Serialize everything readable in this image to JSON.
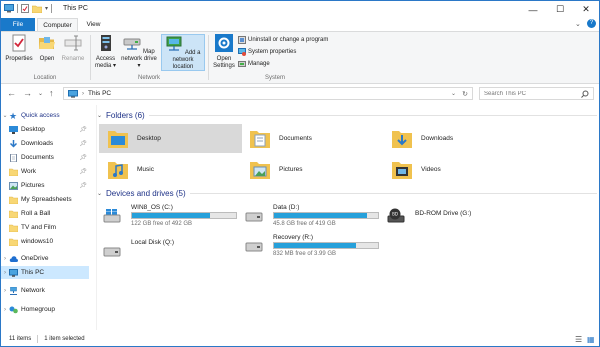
{
  "window": {
    "title": "This PC"
  },
  "tabs": {
    "file": "File",
    "computer": "Computer",
    "view": "View"
  },
  "ribbon": {
    "location": {
      "label": "Location",
      "properties": "Properties",
      "open": "Open",
      "rename": "Rename"
    },
    "network": {
      "label": "Network",
      "access_media": "Access media",
      "map_drive": "Map network drive",
      "add_location": "Add a network location"
    },
    "system": {
      "label": "System",
      "open_settings": "Open Settings",
      "uninstall": "Uninstall or change a program",
      "system_properties": "System properties",
      "manage": "Manage"
    }
  },
  "address": {
    "path": "This PC",
    "search_placeholder": "Search This PC"
  },
  "sidebar": {
    "quick_access": "Quick access",
    "items": [
      {
        "label": "Desktop",
        "pinned": true
      },
      {
        "label": "Downloads",
        "pinned": true
      },
      {
        "label": "Documents",
        "pinned": true
      },
      {
        "label": "Work",
        "pinned": true
      },
      {
        "label": "Pictures",
        "pinned": true
      },
      {
        "label": "My Spreadsheets",
        "pinned": false
      },
      {
        "label": "Roll a Ball",
        "pinned": false
      },
      {
        "label": "TV and Film",
        "pinned": false
      },
      {
        "label": "windows10",
        "pinned": false
      }
    ],
    "onedrive": "OneDrive",
    "this_pc": "This PC",
    "network": "Network",
    "homegroup": "Homegroup"
  },
  "folders": {
    "heading": "Folders (6)",
    "items": [
      "Desktop",
      "Documents",
      "Downloads",
      "Music",
      "Pictures",
      "Videos"
    ]
  },
  "drives": {
    "heading": "Devices and drives (5)",
    "items": [
      {
        "name": "WIN8_OS (C:)",
        "free": "122 GB free of 492 GB",
        "used": 0.75
      },
      {
        "name": "Data (D:)",
        "free": "45.8 GB free of 419 GB",
        "used": 0.89
      },
      {
        "name": "BD-ROM Drive (G:)"
      },
      {
        "name": "Local Disk (Q:)"
      },
      {
        "name": "Recovery (R:)",
        "free": "832 MB free of 3.99 GB",
        "used": 0.79
      }
    ]
  },
  "status": {
    "count": "11 items",
    "selected": "1 item selected"
  },
  "colors": {
    "accent": "#1979ca",
    "drive_bar": "#26a0da",
    "folder": "#f8d775",
    "selection": "#cce8ff"
  }
}
